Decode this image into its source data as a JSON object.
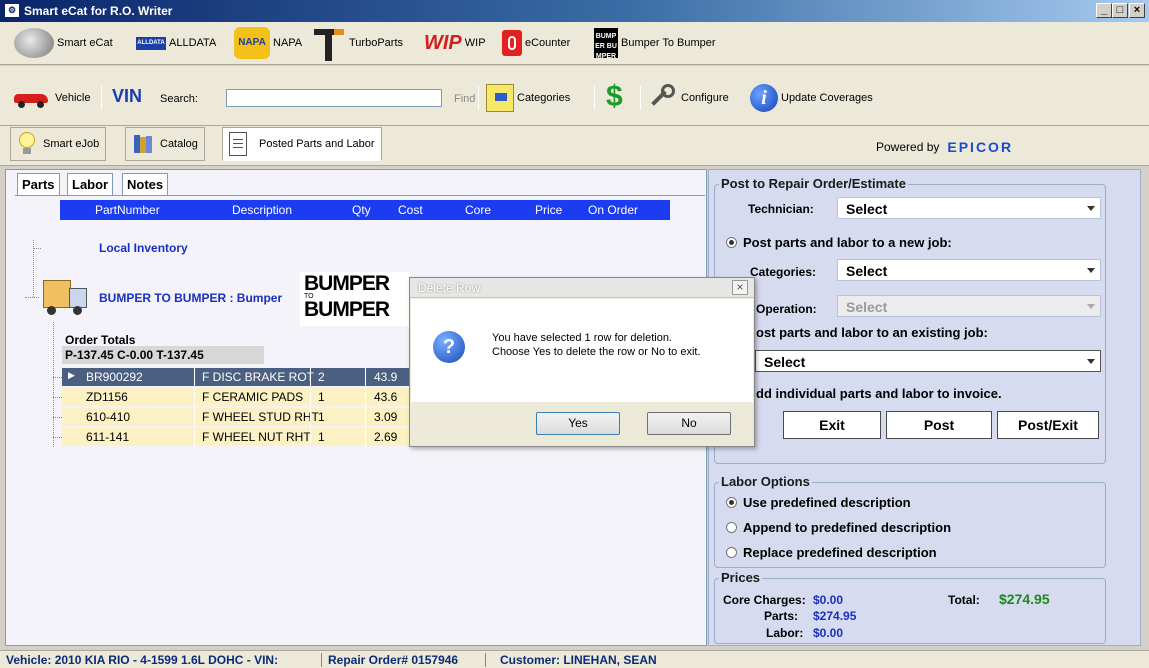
{
  "window": {
    "title": "Smart eCat for R.O. Writer",
    "controls": [
      "_",
      "□",
      "×"
    ]
  },
  "toolbar1": [
    {
      "label": "Smart eCat",
      "icon": "smart-ecat-icon"
    },
    {
      "label": "ALLDATA",
      "icon": "alldata-icon",
      "badge": "ALLDATA"
    },
    {
      "label": "NAPA",
      "icon": "napa-icon",
      "badge": "NAPA"
    },
    {
      "label": "TurboParts",
      "icon": "turboparts-icon"
    },
    {
      "label": "WIP",
      "icon": "wip-icon",
      "badge": "WIP"
    },
    {
      "label": "eCounter",
      "icon": "ecounter-icon"
    },
    {
      "label": "Bumper To Bumper",
      "icon": "bumper-to-bumper-icon",
      "badge": "BUMPER BUMPER"
    }
  ],
  "toolbar2": {
    "vehicle_label": "Vehicle",
    "vin_badge": "VIN",
    "search_label": "Search:",
    "search_value": "",
    "find_label": "Find",
    "categories_label": "Categories",
    "dollar_glyph": "$",
    "configure_label": "Configure",
    "info_glyph": "i",
    "update_label": "Update Coverages"
  },
  "tabs": [
    {
      "label": "Smart eJob",
      "icon": "lightbulb-icon"
    },
    {
      "label": "Catalog",
      "icon": "catalog-books-icon"
    },
    {
      "label": "Posted Parts and Labor",
      "icon": "clipboard-icon"
    }
  ],
  "powered_by": {
    "prefix": "Powered by",
    "brand": "EPICOR"
  },
  "subtabs": [
    "Parts",
    "Labor",
    "Notes"
  ],
  "grid": {
    "headers": [
      "PartNumber",
      "Description",
      "Qty",
      "Cost",
      "Core",
      "Price",
      "On Order"
    ],
    "local_inventory": "Local Inventory",
    "supplier": "BUMPER TO BUMPER : Bumper",
    "supplier_logo_top": "BUMPER",
    "supplier_logo_bottom": "BUMPER",
    "supplier_logo_mid": "TO",
    "order_totals_label": "Order Totals",
    "order_totals": "P-137.45 C-0.00 T-137.45",
    "rows": [
      {
        "part": "BR900292",
        "desc": "F DISC BRAKE ROT",
        "qty": "2",
        "cost": "43.9",
        "selected": true
      },
      {
        "part": "ZD1156",
        "desc": "F CERAMIC PADS",
        "qty": "1",
        "cost": "43.6",
        "selected": false
      },
      {
        "part": "610-410",
        "desc": "F WHEEL STUD RHT",
        "qty": "1",
        "cost": "3.09",
        "selected": false
      },
      {
        "part": "611-141",
        "desc": "F WHEEL NUT RHT",
        "qty": "1",
        "cost": "2.69",
        "selected": false
      }
    ]
  },
  "dialog": {
    "title": "Delete Row",
    "message_line1": "You have selected 1 row for deletion.",
    "message_line2": "Choose Yes to delete the row or No to exit.",
    "yes": "Yes",
    "no": "No",
    "close": "×",
    "icon_glyph": "?"
  },
  "post_group": {
    "title": "Post to Repair Order/Estimate",
    "technician_label": "Technician:",
    "technician_value": "Select",
    "new_job_label": "Post parts and labor to a new job:",
    "categories_label": "Categories:",
    "categories_value": "Select",
    "operation_label": "Operation:",
    "operation_value": "Select",
    "existing_job_label": "ost parts and labor to an existing job:",
    "existing_job_value": "Select",
    "individual_label": "dd individual parts and labor to invoice.",
    "exit": "Exit",
    "post": "Post",
    "post_exit": "Post/Exit"
  },
  "labor_options": {
    "title": "Labor Options",
    "options": [
      "Use predefined description",
      "Append to predefined description",
      "Replace predefined description"
    ],
    "selected_index": 0
  },
  "prices": {
    "title": "Prices",
    "core_label": "Core Charges:",
    "core_value": "$0.00",
    "parts_label": "Parts:",
    "parts_value": "$274.95",
    "labor_label": "Labor:",
    "labor_value": "$0.00",
    "total_label": "Total:",
    "total_value": "$274.95"
  },
  "status": {
    "vehicle": "Vehicle: 2010 KIA RIO - 4-1599 1.6L DOHC - VIN:",
    "repair_order": "Repair Order# 0157946",
    "customer": "Customer: LINEHAN, SEAN"
  },
  "colors": {
    "grid_header": "#1b3cf0",
    "row_bg": "#fbf1c3",
    "row_selected": "#4b5f80",
    "link_blue": "#1a2fbf",
    "total_green": "#1a8a1a",
    "epicor_blue": "#1a4ad0"
  }
}
